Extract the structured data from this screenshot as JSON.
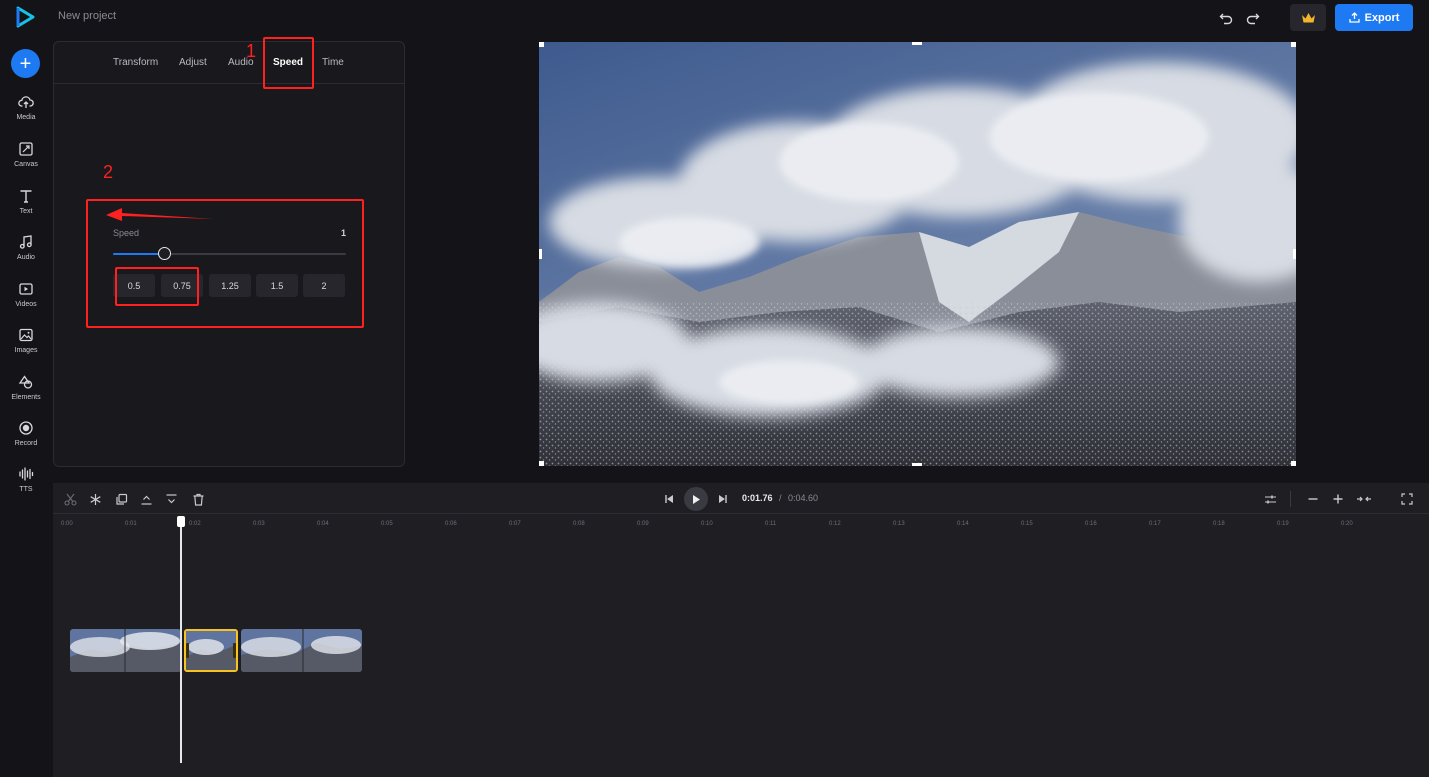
{
  "header": {
    "project_name": "New project",
    "export_label": "Export",
    "icons": [
      "logo-icon",
      "undo-icon",
      "redo-icon",
      "crown-icon",
      "upload-icon"
    ]
  },
  "sidebar": {
    "items": [
      {
        "label": "Media",
        "icon": "cloud-upload-icon"
      },
      {
        "label": "Canvas",
        "icon": "canvas-icon"
      },
      {
        "label": "Text",
        "icon": "text-icon"
      },
      {
        "label": "Audio",
        "icon": "music-note-icon"
      },
      {
        "label": "Videos",
        "icon": "video-icon"
      },
      {
        "label": "Images",
        "icon": "image-icon"
      },
      {
        "label": "Elements",
        "icon": "shapes-icon"
      },
      {
        "label": "Record",
        "icon": "record-icon"
      },
      {
        "label": "TTS",
        "icon": "waveform-icon"
      }
    ]
  },
  "panel": {
    "tabs": [
      "Transform",
      "Adjust",
      "Audio",
      "Speed",
      "Time"
    ],
    "active_tab": "Speed",
    "speed": {
      "label": "Speed",
      "value": "1",
      "slider_fraction": 0.22,
      "presets": [
        "0.5",
        "0.75",
        "1.25",
        "1.5",
        "2"
      ]
    }
  },
  "annotations": {
    "numbers": [
      "1",
      "2"
    ],
    "color": "#ff2020"
  },
  "timeline": {
    "current_time": "0:01.76",
    "separator": "/",
    "total_time": "0:04.60",
    "ruler": [
      "0:00",
      "0:01",
      "0:02",
      "0:03",
      "0:04",
      "0:05",
      "0:06",
      "0:07",
      "0:08",
      "0:09",
      "0:10",
      "0:11",
      "0:12",
      "0:13",
      "0:14",
      "0:15",
      "0:16",
      "0:17",
      "0:18",
      "0:19",
      "0:20"
    ],
    "tools": [
      "scissors-icon",
      "freeze-icon",
      "duplicate-icon",
      "move-up-icon",
      "move-down-icon",
      "trash-icon"
    ],
    "right_tools": [
      "adjust-icon",
      "zoom-out-icon",
      "zoom-in-icon",
      "fit-icon",
      "fullscreen-icon"
    ],
    "clips": 3,
    "selected_clip": 2
  },
  "colors": {
    "accent": "#1d7af2",
    "selected_clip_border": "#f6c323",
    "background": "#141418",
    "panel": "#18181d"
  }
}
